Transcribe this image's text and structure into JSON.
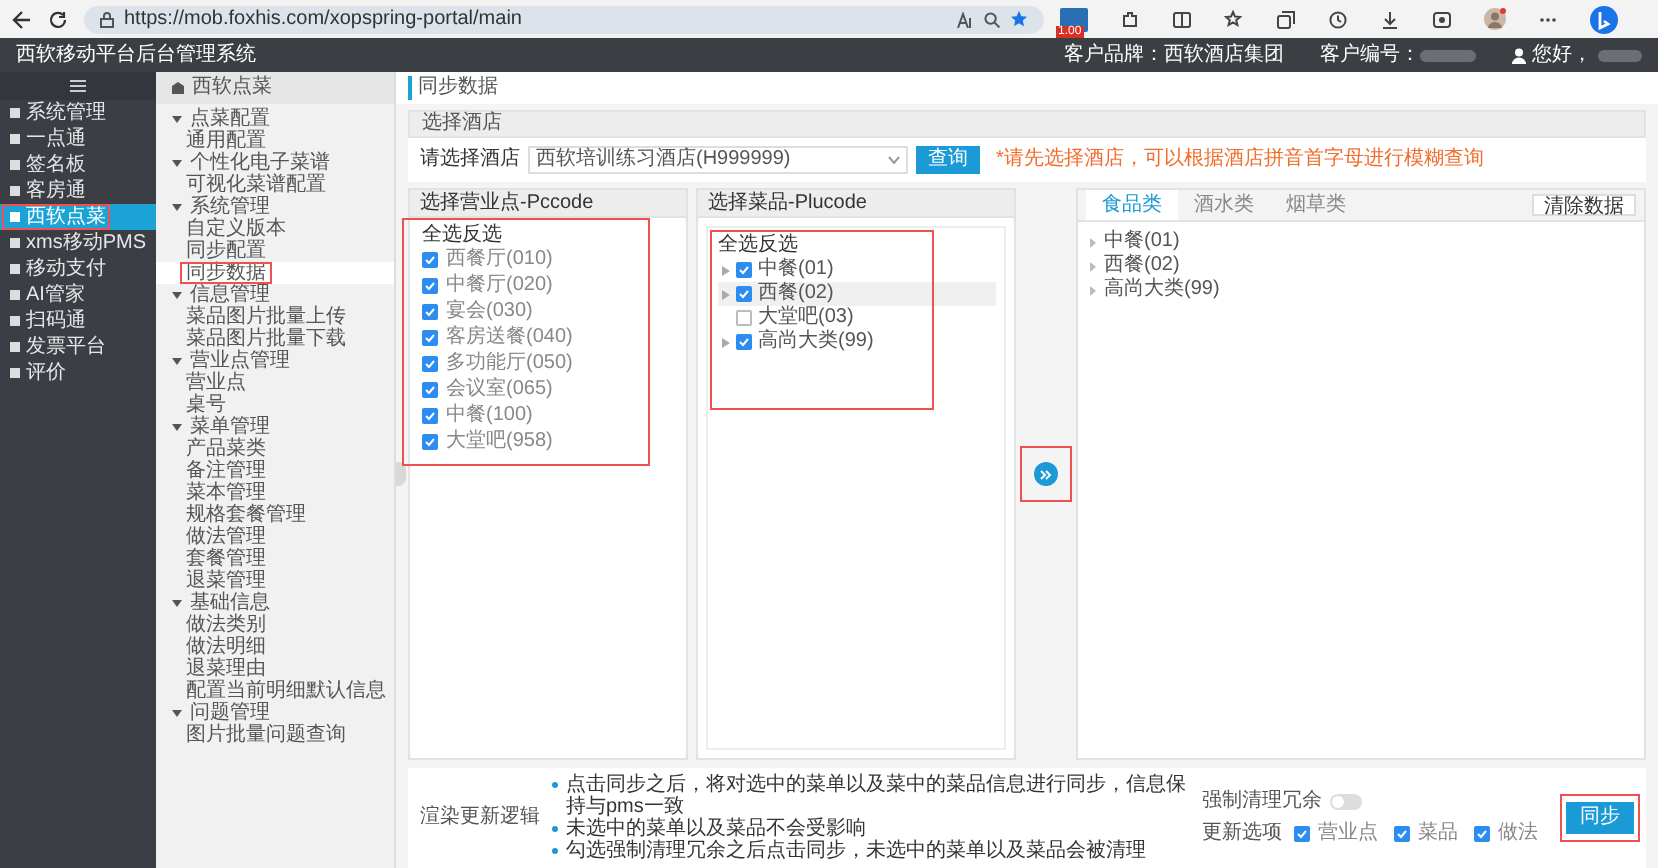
{
  "browser": {
    "url": "https://mob.foxhis.com/xopspring-portal/main",
    "extension_badge": "1.00"
  },
  "header": {
    "title": "西软移动平台后台管理系统",
    "brand": "客户品牌：西软酒店集团",
    "customer": "客户编号：",
    "user": "您好，"
  },
  "sidebar": {
    "items": [
      {
        "label": "系统管理",
        "selected": false
      },
      {
        "label": "一点通",
        "selected": false
      },
      {
        "label": "签名板",
        "selected": false
      },
      {
        "label": "客房通",
        "selected": false
      },
      {
        "label": "西软点菜",
        "selected": true
      },
      {
        "label": "xms移动PMS",
        "selected": false
      },
      {
        "label": "移动支付",
        "selected": false
      },
      {
        "label": "AI管家",
        "selected": false
      },
      {
        "label": "扫码通",
        "selected": false
      },
      {
        "label": "发票平台",
        "selected": false
      },
      {
        "label": "评价",
        "selected": false
      }
    ]
  },
  "submenu": {
    "title": "西软点菜",
    "groups": [
      {
        "label": "点菜配置",
        "expanded": true,
        "children": [
          {
            "label": "通用配置",
            "selected": false
          }
        ]
      },
      {
        "label": "个性化电子菜谱",
        "expanded": true,
        "children": [
          {
            "label": "可视化菜谱配置",
            "selected": false
          }
        ]
      },
      {
        "label": "系统管理",
        "expanded": true,
        "children": [
          {
            "label": "自定义版本",
            "selected": false
          },
          {
            "label": "同步配置",
            "selected": false
          },
          {
            "label": "同步数据",
            "selected": true
          }
        ]
      },
      {
        "label": "信息管理",
        "expanded": true,
        "children": [
          {
            "label": "菜品图片批量上传",
            "selected": false
          },
          {
            "label": "菜品图片批量下载",
            "selected": false
          }
        ]
      },
      {
        "label": "营业点管理",
        "expanded": true,
        "children": [
          {
            "label": "营业点",
            "selected": false
          },
          {
            "label": "桌号",
            "selected": false
          }
        ]
      },
      {
        "label": "菜单管理",
        "expanded": true,
        "children": [
          {
            "label": "产品菜类",
            "selected": false
          },
          {
            "label": "备注管理",
            "selected": false
          },
          {
            "label": "菜本管理",
            "selected": false
          },
          {
            "label": "规格套餐管理",
            "selected": false
          },
          {
            "label": "做法管理",
            "selected": false
          },
          {
            "label": "套餐管理",
            "selected": false
          },
          {
            "label": "退菜管理",
            "selected": false
          }
        ]
      },
      {
        "label": "基础信息",
        "expanded": true,
        "children": [
          {
            "label": "做法类别",
            "selected": false
          },
          {
            "label": "做法明细",
            "selected": false
          },
          {
            "label": "退菜理由",
            "selected": false
          },
          {
            "label": "配置当前明细默认信息",
            "selected": false
          }
        ]
      },
      {
        "label": "问题管理",
        "expanded": true,
        "children": [
          {
            "label": "图片批量问题查询",
            "selected": false
          }
        ]
      }
    ]
  },
  "breadcrumb": "同步数据",
  "hotel_section": {
    "title": "选择酒店",
    "label": "请选择酒店",
    "value": "西软培训练习酒店(H999999)",
    "button": "查询",
    "note": "*请先选择酒店，可以根据酒店拼音首字母进行模糊查询"
  },
  "pccode_panel": {
    "title": "选择营业点-Pccode",
    "select_all": "全选反选",
    "items": [
      {
        "label": "西餐厅(010)",
        "checked": true
      },
      {
        "label": "中餐厅(020)",
        "checked": true
      },
      {
        "label": "宴会(030)",
        "checked": true
      },
      {
        "label": "客房送餐(040)",
        "checked": true
      },
      {
        "label": "多功能厅(050)",
        "checked": true
      },
      {
        "label": "会议室(065)",
        "checked": true
      },
      {
        "label": "中餐(100)",
        "checked": true
      },
      {
        "label": "大堂吧(958)",
        "checked": true
      }
    ]
  },
  "plucode_panel": {
    "title": "选择菜品-Plucode",
    "select_all": "全选反选",
    "items": [
      {
        "label": "中餐(01)",
        "checked": true,
        "selected": false,
        "has_children": true
      },
      {
        "label": "西餐(02)",
        "checked": true,
        "selected": true,
        "has_children": true
      },
      {
        "label": "大堂吧(03)",
        "checked": false,
        "selected": false,
        "has_children": false
      },
      {
        "label": "高尚大类(99)",
        "checked": true,
        "selected": false,
        "has_children": true
      }
    ]
  },
  "result_panel": {
    "tabs": [
      {
        "label": "食品类",
        "selected": true
      },
      {
        "label": "酒水类",
        "selected": false
      },
      {
        "label": "烟草类",
        "selected": false
      }
    ],
    "clear_button": "清除数据",
    "items": [
      "中餐(01)",
      "西餐(02)",
      "高尚大类(99)"
    ]
  },
  "footer": {
    "label": "渲染更新逻辑",
    "notes": [
      "点击同步之后，将对选中的菜单以及菜中的菜品信息进行同步，信息保持与pms一致",
      "未选中的菜单以及菜品不会受影响",
      "勾选强制清理冗余之后点击同步，未选中的菜单以及菜品会被清理"
    ],
    "force_clean": {
      "label": "强制清理冗余",
      "on": false
    },
    "update_options": {
      "label": "更新选项",
      "options": [
        {
          "label": "营业点",
          "checked": true
        },
        {
          "label": "菜品",
          "checked": true
        },
        {
          "label": "做法",
          "checked": true
        }
      ]
    },
    "sync_button": "同步"
  }
}
